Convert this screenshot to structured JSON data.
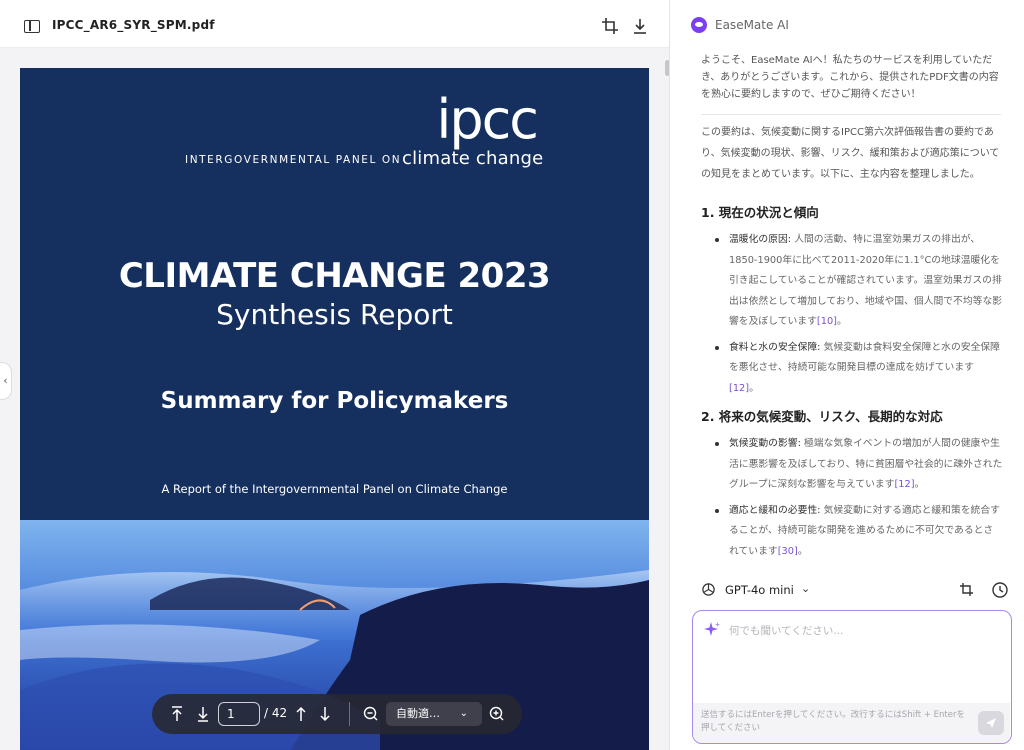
{
  "pdf": {
    "file_name": "IPCC_AR6_SYR_SPM.pdf",
    "cover": {
      "logo": "ipcc",
      "org_line_1": "INTERGOVERNMENTAL PANEL ON",
      "org_line_2": "climate change",
      "title": "CLIMATE CHANGE 2023",
      "subtitle": "Synthesis Report",
      "heading": "Summary for Policymakers",
      "byline": "A Report of the Intergovernmental Panel on Climate Change"
    },
    "toolbar": {
      "current_page": "1",
      "total_pages": "/ 42",
      "zoom": "自動適…"
    },
    "colors": {
      "cover_bg": "#15305f"
    }
  },
  "ai": {
    "brand": "EaseMate AI",
    "welcome": "ようこそ、EaseMate AIへ！私たちのサービスを利用していただき、ありがとうございます。これから、提供されたPDF文書の内容を熟心に要約しますので、ぜひご期待ください！",
    "intro": "この要約は、気候変動に関するIPCC第六次評価報告書の要約であり、気候変動の現状、影響、リスク、緩和策および適応策についての知見をまとめています。以下に、主な内容を整理しました。",
    "sections": [
      {
        "heading": "1. 現在の状況と傾向",
        "items": [
          {
            "label": "温暖化の原因:",
            "text": " 人間の活動、特に温室効果ガスの排出が、1850-1900年に比べて2011-2020年に1.1°Cの地球温暖化を引き起こしていることが確認されています。温室効果ガスの排出は依然として増加しており、地域や国、個人間で不均等な影響を及ぼしています",
            "ref": "[10]",
            "end": "。"
          },
          {
            "label": "食料と水の安全保障:",
            "text": " 気候変動は食料安全保障と水の安全保障を悪化させ、持続可能な開発目標の達成を妨げています",
            "ref": "[12]",
            "end": "。"
          }
        ]
      },
      {
        "heading": "2. 将来の気候変動、リスク、長期的な対応",
        "items": [
          {
            "label": "気候変動の影響:",
            "text": " 極端な気象イベントの増加が人間の健康や生活に悪影響を及ぼしており、特に貧困層や社会的に疎外されたグループに深刻な影響を与えています",
            "ref": "[12]",
            "end": "。"
          },
          {
            "label": "適応と緩和の必要性:",
            "text": " 気候変動に対する適応と緩和策を統合することが、持続可能な開発を進めるために不可欠であるとされています",
            "ref": "[30]",
            "end": "。"
          }
        ]
      }
    ],
    "model": "GPT-4o mini",
    "input_placeholder": "何でも聞いてください...",
    "input_hint": "送信するにはEnterを押してください。改行するにはShift + Enterを押してください",
    "colors": {
      "accent": "#7a3ff0",
      "input_border": "#a987f0",
      "ref": "#7a4fd6"
    }
  }
}
